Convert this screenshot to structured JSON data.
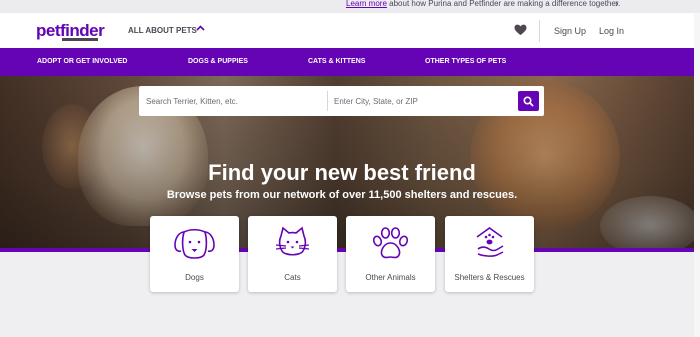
{
  "promo": {
    "link_text": "Learn more",
    "text": " about how Purina and Petfinder are making a difference together."
  },
  "header": {
    "logo": "petfinder",
    "all_about_pets": "ALL ABOUT PETS",
    "sign_up": "Sign Up",
    "log_in": "Log In"
  },
  "nav": [
    {
      "label": "ADOPT OR GET INVOLVED"
    },
    {
      "label": "DOGS & PUPPIES"
    },
    {
      "label": "CATS & KITTENS"
    },
    {
      "label": "OTHER TYPES OF PETS"
    }
  ],
  "search": {
    "pet_placeholder": "Search Terrier, Kitten, etc.",
    "location_placeholder": "Enter City, State, or ZIP"
  },
  "hero": {
    "title": "Find your new best friend",
    "subtitle": "Browse pets from our network of over 11,500 shelters and rescues."
  },
  "cards": [
    {
      "label": "Dogs",
      "icon": "dog-icon"
    },
    {
      "label": "Cats",
      "icon": "cat-icon"
    },
    {
      "label": "Other Animals",
      "icon": "paw-icon"
    },
    {
      "label": "Shelters & Rescues",
      "icon": "shelter-icon"
    }
  ],
  "colors": {
    "brand_purple": "#6504b5",
    "text_dark": "#4d4751"
  }
}
